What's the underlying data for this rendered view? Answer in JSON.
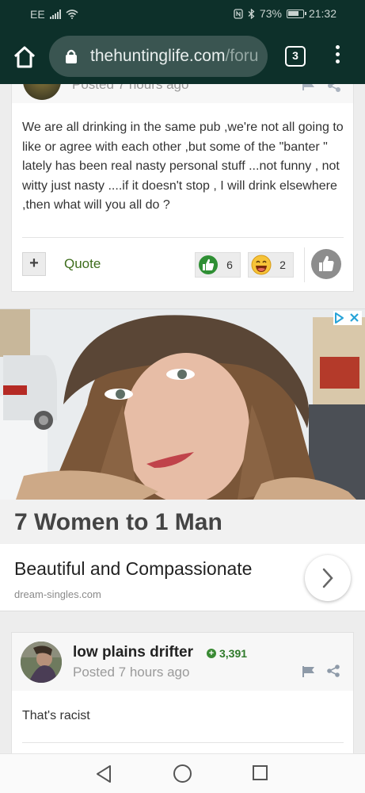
{
  "status_bar": {
    "carrier": "EE",
    "battery": "73%",
    "time": "21:32"
  },
  "browser": {
    "url_domain": "thehuntinglife.com",
    "url_path": "/foru",
    "tab_count": "3"
  },
  "post1": {
    "posted": "Posted 7 hours ago",
    "body": "We are all drinking in the same pub ,we're not all going to like or agree with each other ,but some of the \"banter \" lately has been real nasty personal stuff ...not funny , not witty just nasty ....if it doesn't stop , I will drink elsewhere ,then what will you all do ?",
    "plus_label": "+",
    "quote_label": "Quote",
    "reactions": [
      {
        "icon": "thumbs-up-icon",
        "count": "6"
      },
      {
        "icon": "laugh-icon",
        "count": "2"
      }
    ]
  },
  "ad": {
    "title": "7 Women to 1 Man",
    "subtitle": "Beautiful and Compassionate",
    "domain": "dream-singles.com"
  },
  "post2": {
    "author": "low plains drifter",
    "reputation": "3,391",
    "posted": "Posted 7 hours ago",
    "body": "That's racist"
  },
  "colors": {
    "topbar": "#0d302a",
    "link_green": "#3e6d1c",
    "reputation_green": "#2f7a2a"
  }
}
